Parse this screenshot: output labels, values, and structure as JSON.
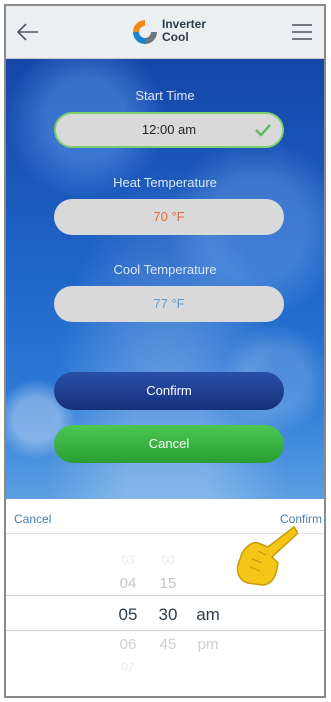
{
  "header": {
    "logo_line1": "Inverter",
    "logo_line2": "Cool",
    "back_icon": "arrow-left-icon",
    "menu_icon": "hamburger-icon"
  },
  "form": {
    "start_time_label": "Start Time",
    "start_time_value": "12:00 am",
    "heat_label": "Heat Temperature",
    "heat_value": "70 °F",
    "cool_label": "Cool Temperature",
    "cool_value": "77 °F",
    "confirm_label": "Confirm",
    "cancel_label": "Cancel"
  },
  "picker": {
    "cancel_label": "Cancel",
    "confirm_label": "Confirm",
    "hours": [
      "03",
      "04",
      "05",
      "06",
      "07"
    ],
    "minutes": [
      "00",
      "15",
      "30",
      "45"
    ],
    "ampm": [
      "am",
      "pm"
    ],
    "selected": {
      "hour": "05",
      "minute": "30",
      "ampm": "am"
    }
  },
  "colors": {
    "accent_blue": "#16307a",
    "accent_green": "#2a9e33",
    "heat": "#e26a3f",
    "cool": "#5a9fd4",
    "check": "#5cb85c"
  }
}
